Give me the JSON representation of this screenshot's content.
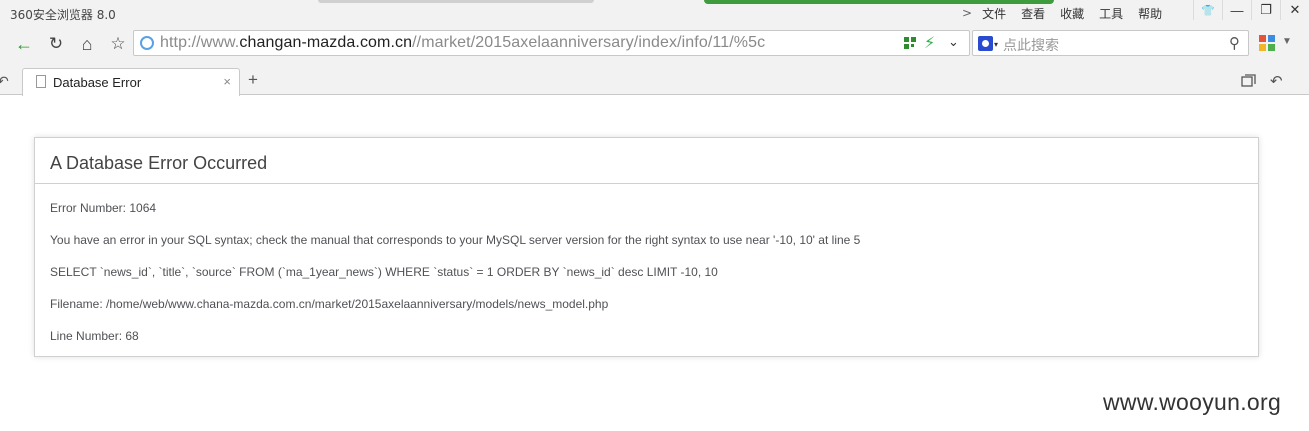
{
  "browser": {
    "app_title": "360安全浏览器 8.0",
    "menu": {
      "chevron": ">",
      "items": [
        "文件",
        "查看",
        "收藏",
        "工具",
        "帮助"
      ]
    },
    "window_buttons": {
      "shirt": "👕",
      "minimize": "—",
      "restore": "❐",
      "close": "✕"
    },
    "nav": {
      "back": "←",
      "reload": "↻",
      "home": "⌂",
      "favorite": "☆"
    },
    "address": {
      "url_prefix": "http://www.",
      "url_host": "changan-mazda.com.cn",
      "url_path": "//market/2015axelaanniversary/index/info/11/%5c",
      "dropdown": "⌄"
    },
    "search": {
      "placeholder": "点此搜索",
      "baidu_dropdown": "▾",
      "magnifier": "⚲"
    },
    "tabs": [
      {
        "label": "Database Error",
        "close": "×"
      }
    ],
    "new_tab": "+",
    "tab_restore": "↶",
    "tab_undo": "↶"
  },
  "page": {
    "error_title": "A Database Error Occurred",
    "lines": [
      "Error Number: 1064",
      "You have an error in your SQL syntax; check the manual that corresponds to your MySQL server version for the right syntax to use near '-10, 10' at line 5",
      "SELECT `news_id`, `title`, `source` FROM (`ma_1year_news`) WHERE `status` = 1 ORDER BY `news_id` desc LIMIT -10, 10",
      "Filename: /home/web/www.chana-mazda.com.cn/market/2015axelaanniversary/models/news_model.php",
      "Line Number: 68"
    ]
  },
  "watermark": "www.wooyun.org",
  "colors": {
    "chrome_bg": "#f2f2f2",
    "accent_green": "#3e9b3e",
    "back_arrow": "#2a9a2a",
    "bolt": "#2fb24a",
    "baidu": "#2a4bd0"
  }
}
